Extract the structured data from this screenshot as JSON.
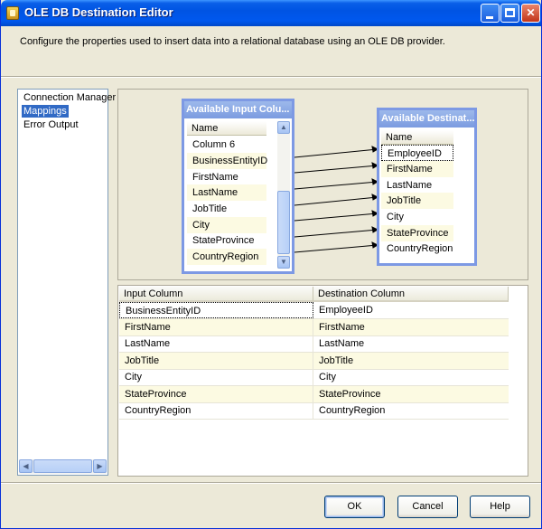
{
  "window": {
    "title": "OLE DB Destination Editor"
  },
  "description": "Configure the properties used to insert data into a relational database using an OLE DB provider.",
  "nav": {
    "items": [
      {
        "label": "Connection Manager",
        "selected": false
      },
      {
        "label": "Mappings",
        "selected": true
      },
      {
        "label": "Error Output",
        "selected": false
      }
    ]
  },
  "input_table": {
    "title": "Available Input Colu...",
    "header": "Name",
    "columns": [
      "Column 6",
      "BusinessEntityID",
      "FirstName",
      "LastName",
      "JobTitle",
      "City",
      "StateProvince",
      "CountryRegion"
    ]
  },
  "dest_table": {
    "title": "Available Destinat...",
    "header": "Name",
    "columns": [
      "EmployeeID",
      "FirstName",
      "LastName",
      "JobTitle",
      "City",
      "StateProvince",
      "CountryRegion"
    ]
  },
  "grid": {
    "headers": [
      "Input Column",
      "Destination Column"
    ],
    "rows": [
      [
        "BusinessEntityID",
        "EmployeeID"
      ],
      [
        "FirstName",
        "FirstName"
      ],
      [
        "LastName",
        "LastName"
      ],
      [
        "JobTitle",
        "JobTitle"
      ],
      [
        "City",
        "City"
      ],
      [
        "StateProvince",
        "StateProvince"
      ],
      [
        "CountryRegion",
        "CountryRegion"
      ]
    ]
  },
  "buttons": {
    "ok": "OK",
    "cancel": "Cancel",
    "help": "Help"
  },
  "colors": {
    "titlebar": "#0054e3",
    "selection": "#316ac5",
    "row_alt": "#fcfae2",
    "table_border": "#7d99e4"
  }
}
